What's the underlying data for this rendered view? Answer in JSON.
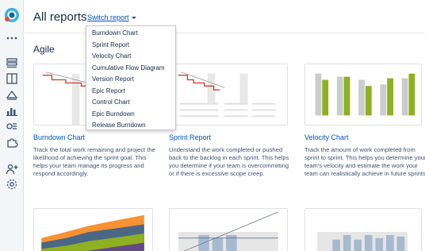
{
  "header": {
    "title": "All reports",
    "switch_label": "Switch report"
  },
  "section": {
    "title": "Agile"
  },
  "dropdown": {
    "items": [
      "Burndown Chart",
      "Sprint Report",
      "Velocity Chart",
      "Cumulative Flow Diagram",
      "Version Report",
      "Epic Report",
      "Control Chart",
      "Epic Burndown",
      "Release Burndown"
    ]
  },
  "cards": [
    {
      "title": "Burndown Chart",
      "description": "Track the total work remaining and project the likelihood of achieving the sprint goal. This helps your team manage its progress and respond accordingly."
    },
    {
      "title": "Sprint Report",
      "description": "Understand the work completed or pushed back to the backlog in each sprint. This helps you determine if your team is overcommitting or if there is excessive scope creep."
    },
    {
      "title": "Velocity Chart",
      "description": "Track the amount of work completed from sprint to sprint. This helps you determine your team's velocity and estimate the work your team can realistically achieve in future sprints."
    }
  ],
  "sidebar": {
    "icons": [
      "more-icon",
      "backlog-icon",
      "board-icon",
      "releases-icon",
      "reports-icon",
      "issues-icon",
      "components-icon",
      "add-people-icon",
      "settings-icon"
    ]
  },
  "colors": {
    "link": "#0052cc",
    "red": "#d04437",
    "green": "#8eb021",
    "gray_bar": "#cccccc",
    "blue_area": "#4a6785",
    "orange": "#f79232",
    "purple": "#654982"
  }
}
